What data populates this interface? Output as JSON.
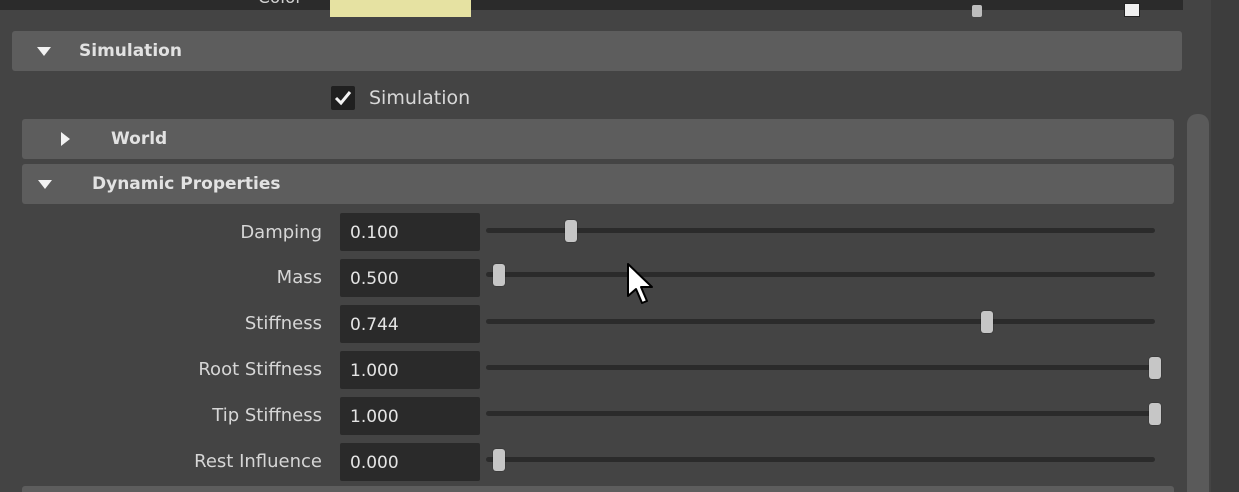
{
  "top_row": {
    "label": "Color",
    "swatch_color": "#e6e2a2"
  },
  "frames": {
    "simulation": {
      "label": "Simulation",
      "expanded": true
    },
    "world": {
      "label": "World",
      "expanded": false
    },
    "dynamic_properties": {
      "label": "Dynamic Properties",
      "expanded": true
    }
  },
  "simulation_checkbox": {
    "label": "Simulation",
    "checked": true
  },
  "attributes": [
    {
      "label": "Damping",
      "value": "0.100",
      "slider_fraction": 0.11
    },
    {
      "label": "Mass",
      "value": "0.500",
      "slider_fraction": 0.0
    },
    {
      "label": "Stiffness",
      "value": "0.744",
      "slider_fraction": 0.744
    },
    {
      "label": "Root Stiffness",
      "value": "1.000",
      "slider_fraction": 1.0
    },
    {
      "label": "Tip Stiffness",
      "value": "1.000",
      "slider_fraction": 1.0
    },
    {
      "label": "Rest Influence",
      "value": "0.000",
      "slider_fraction": 0.0
    }
  ],
  "icons": {
    "expand": "triangle-down-icon",
    "collapse": "triangle-right-icon",
    "check": "checkmark-icon",
    "cursor": "mouse-pointer-icon"
  }
}
